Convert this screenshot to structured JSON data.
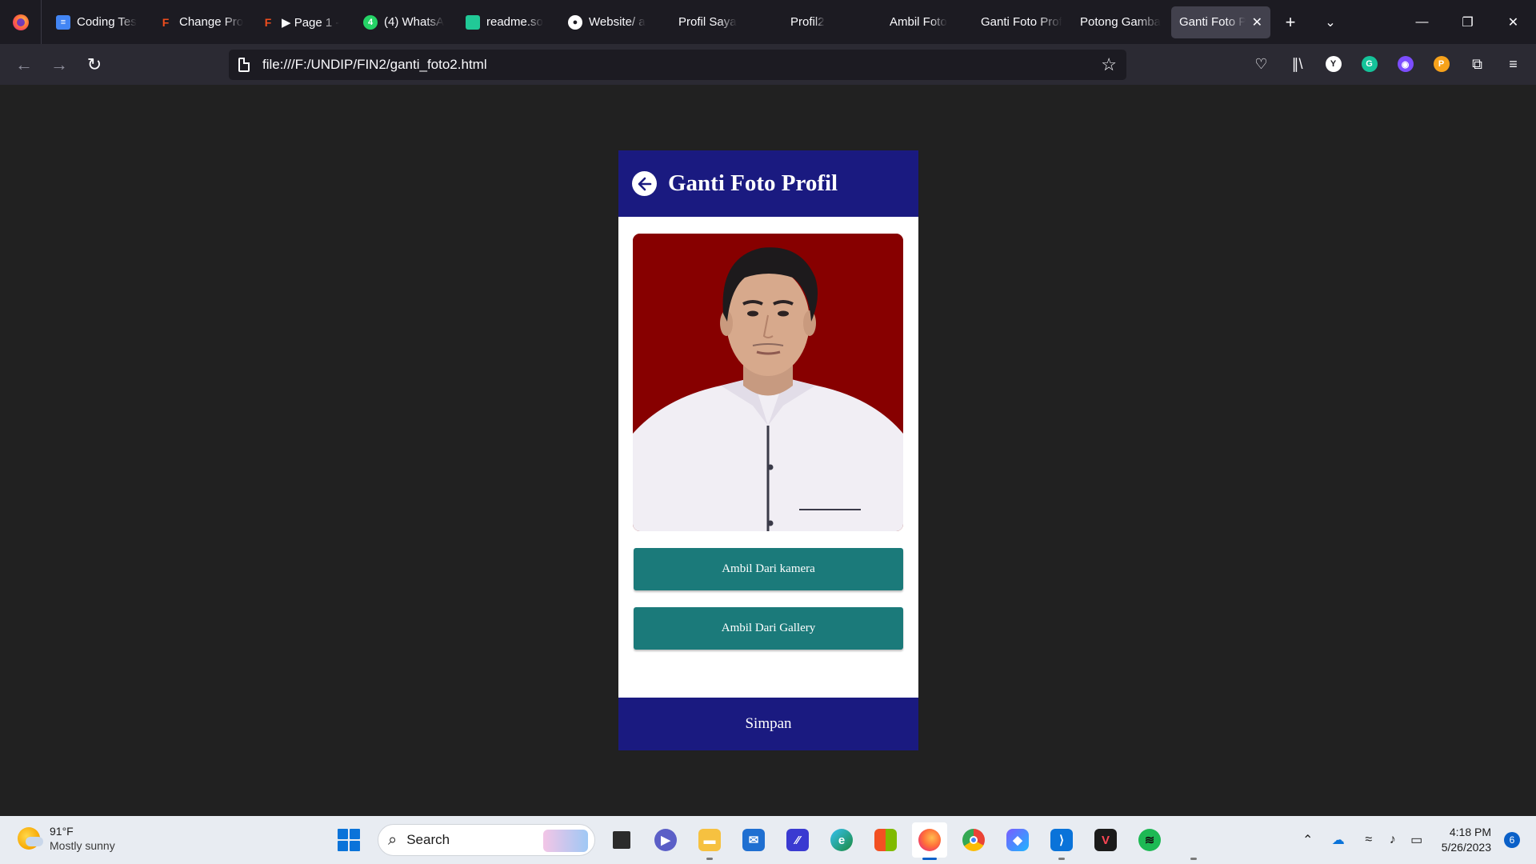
{
  "browser": {
    "tabs": [
      {
        "title": "Coding Tes",
        "icon": "docs-icon",
        "color": "#4285f4"
      },
      {
        "title": "Change Pro",
        "icon": "figma-icon",
        "color": "#f24e1e"
      },
      {
        "title": "▶ Page 1 -",
        "icon": "figma-icon",
        "color": "#f24e1e"
      },
      {
        "title": "(4) WhatsA",
        "icon": "whatsapp-icon",
        "color": "#25d366"
      },
      {
        "title": "readme.so",
        "icon": "readme-icon",
        "color": "#21c997"
      },
      {
        "title": "Website/ a",
        "icon": "github-icon",
        "color": "#ffffff"
      },
      {
        "title": "Profil Saya",
        "icon": "",
        "color": ""
      },
      {
        "title": "Profil2",
        "icon": "",
        "color": ""
      },
      {
        "title": "Ambil Foto",
        "icon": "",
        "color": ""
      },
      {
        "title": "Ganti Foto Prof",
        "icon": "",
        "color": ""
      },
      {
        "title": "Potong Gamba",
        "icon": "",
        "color": ""
      },
      {
        "title": "Ganti Foto P",
        "icon": "",
        "color": "",
        "active": true
      }
    ],
    "url": "file:///F:/UNDIP/FIN2/ganti_foto2.html"
  },
  "page": {
    "title": "Ganti Foto Profil",
    "btn_camera": "Ambil Dari kamera",
    "btn_gallery": "Ambil Dari Gallery",
    "btn_save": "Simpan",
    "colors": {
      "header": "#1a1a80",
      "button": "#1b7a7a",
      "photo_bg": "#870000"
    }
  },
  "taskbar": {
    "weather_temp": "91°F",
    "weather_desc": "Mostly sunny",
    "search_label": "Search",
    "time": "4:18 PM",
    "date": "5/26/2023",
    "notifications": "6"
  }
}
